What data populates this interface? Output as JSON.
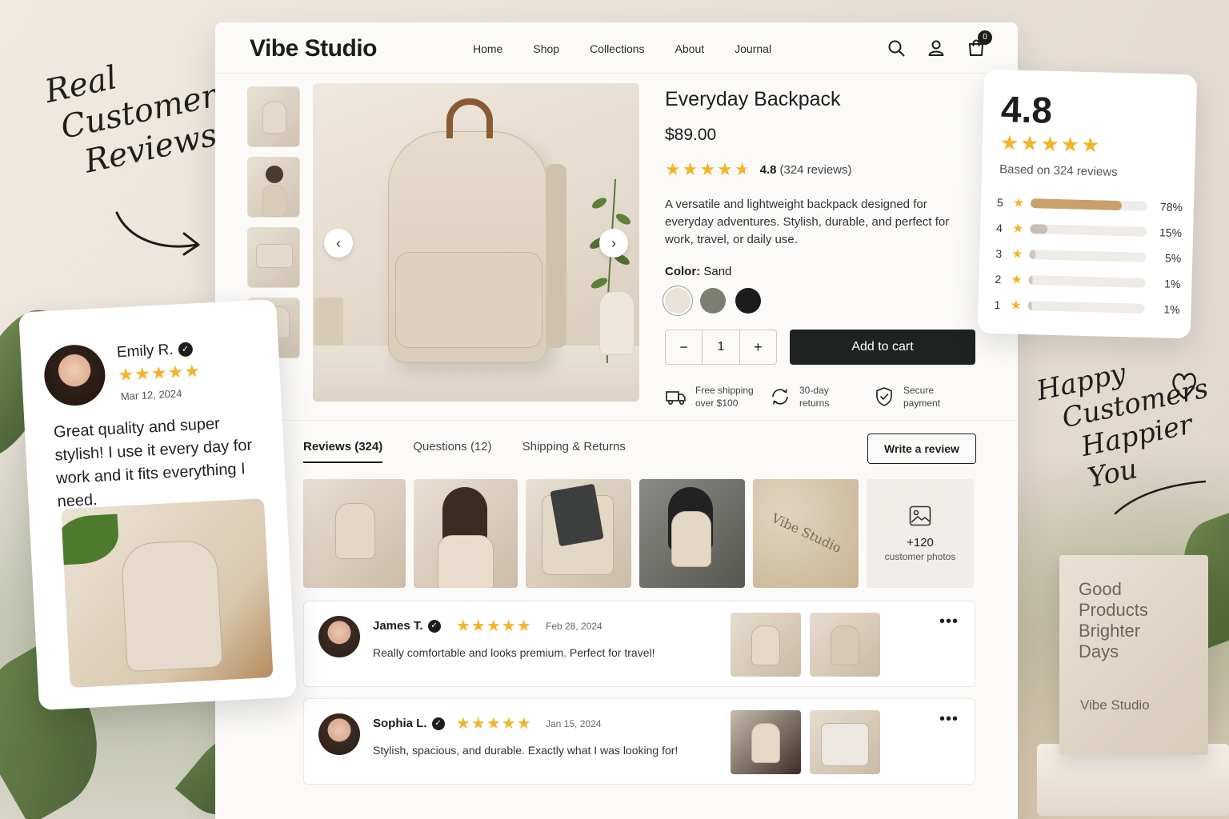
{
  "brand": "Vibe Studio",
  "nav": {
    "items": [
      "Home",
      "Shop",
      "Collections",
      "About",
      "Journal"
    ],
    "cart_count": "0"
  },
  "product": {
    "title": "Everyday Backpack",
    "price": "$89.00",
    "rating": "4.8",
    "rating_stars": 4.8,
    "review_count_text": "(324 reviews)",
    "description": "A versatile and lightweight backpack designed for everyday adventures. Stylish, durable, and perfect for work, travel, or daily use.",
    "color_label": "Color:",
    "color_value": "Sand",
    "swatches": [
      "#e9e2d9",
      "#7b7e72",
      "#1b1c1b"
    ],
    "quantity": "1",
    "minus": "−",
    "plus": "+",
    "add_to_cart": "Add to cart",
    "perks": [
      {
        "line1": "Free shipping",
        "line2": "over $100",
        "icon": "truck-icon"
      },
      {
        "line1": "30-day",
        "line2": "returns",
        "icon": "return-icon"
      },
      {
        "line1": "Secure",
        "line2": "payment",
        "icon": "shield-icon"
      }
    ]
  },
  "tabs": [
    "Reviews (324)",
    "Questions (12)",
    "Shipping & Returns"
  ],
  "write_review": "Write a review",
  "gallery_more": {
    "count": "+120",
    "caption": "customer photos"
  },
  "gallery_logo_text": "Vibe Studio",
  "reviews": [
    {
      "name": "James T.",
      "stars": "★★★★★",
      "date": "Feb 28, 2024",
      "text": "Really comfortable and looks premium. Perfect for travel!"
    },
    {
      "name": "Sophia L.",
      "stars": "★★★★★",
      "date": "Jan 15, 2024",
      "text": "Stylish, spacious, and durable. Exactly what I was looking for!"
    }
  ],
  "rating_summary": {
    "score": "4.8",
    "stars": "★★★★★",
    "based_on": "Based on 324 reviews",
    "distribution": [
      {
        "level": "5",
        "percent": 78,
        "label": "78%"
      },
      {
        "level": "4",
        "percent": 15,
        "label": "15%"
      },
      {
        "level": "3",
        "percent": 5,
        "label": "5%"
      },
      {
        "level": "2",
        "percent": 1,
        "label": "1%"
      },
      {
        "level": "1",
        "percent": 1,
        "label": "1%"
      }
    ]
  },
  "featured_review": {
    "name": "Emily R.",
    "stars": "★★★★★",
    "date": "Mar 12, 2024",
    "text": "Great quality and super stylish! I use it every day for work and it fits everything I need."
  },
  "notes": {
    "left": [
      "Real",
      "Customer",
      "Reviews"
    ],
    "right": [
      "Happy",
      "Customers",
      "Happier You"
    ]
  },
  "box": {
    "tagline": [
      "Good",
      "Products",
      "Brighter",
      "Days"
    ],
    "brand": "Vibe Studio"
  },
  "colors": {
    "accent_star": "#f2b428",
    "bar_fill": "#c9a06a",
    "button_dark": "#1e2220"
  }
}
